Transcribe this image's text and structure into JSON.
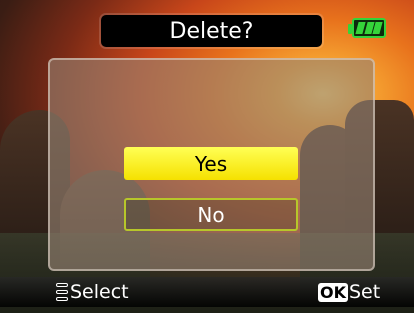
{
  "dialog": {
    "title": "Delete?",
    "options": [
      "Yes",
      "No"
    ],
    "selected": "Yes"
  },
  "battery": {
    "icon": "battery-full-icon",
    "level": 1.0,
    "color": "#35d43a"
  },
  "footer": {
    "select_label": "Select",
    "select_icon": "dial-icon",
    "ok_key": "OK",
    "set_label": "Set"
  },
  "colors": {
    "highlight": "#f5e100",
    "outline": "#b7c62a"
  }
}
